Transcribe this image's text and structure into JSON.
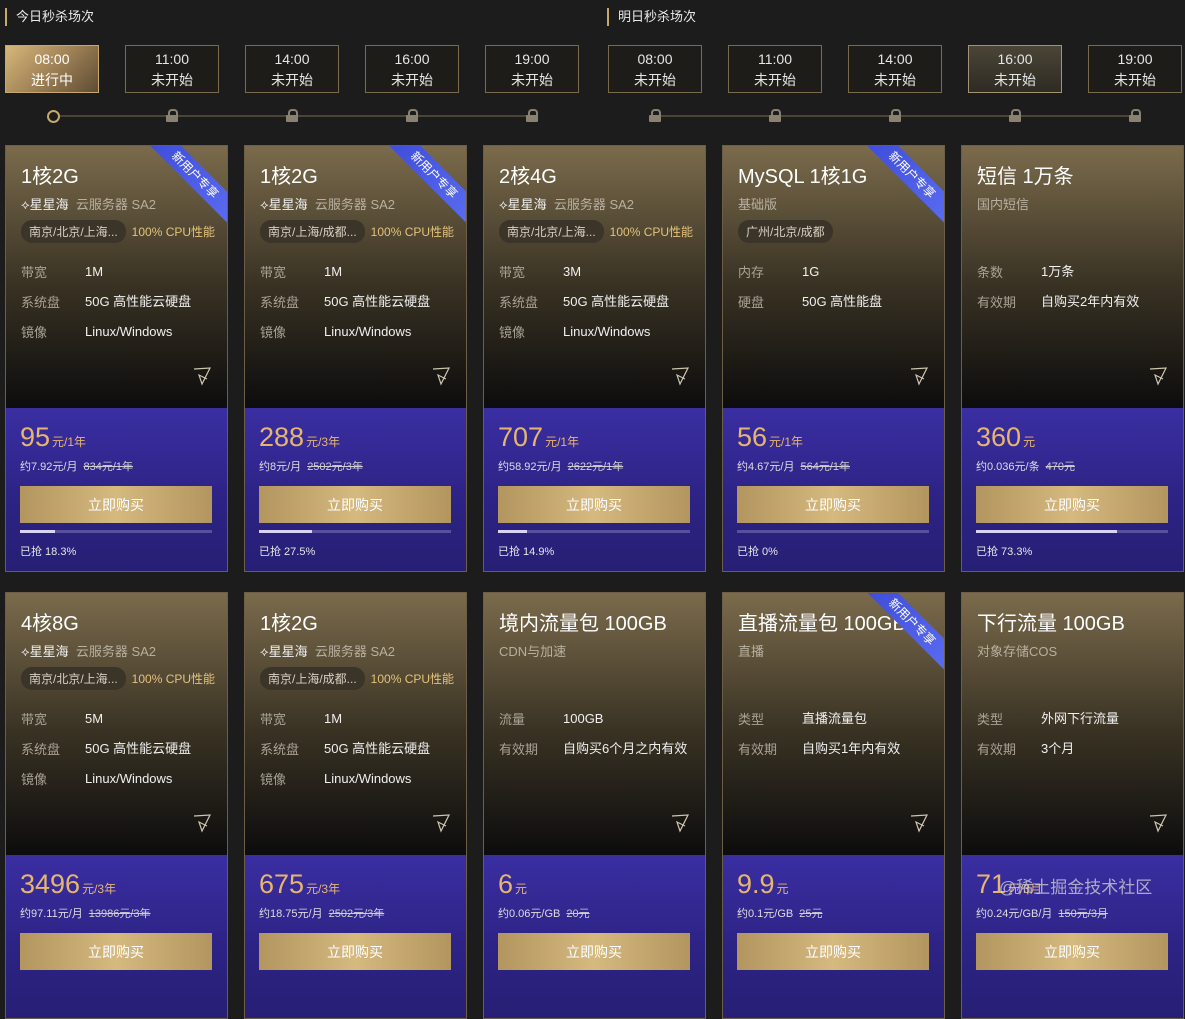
{
  "sections": {
    "today": "今日秒杀场次",
    "tomorrow": "明日秒杀场次"
  },
  "today_slots": [
    {
      "time": "08:00",
      "status": "进行中"
    },
    {
      "time": "11:00",
      "status": "未开始"
    },
    {
      "time": "14:00",
      "status": "未开始"
    },
    {
      "time": "16:00",
      "status": "未开始"
    },
    {
      "time": "19:00",
      "status": "未开始"
    }
  ],
  "tomorrow_slots": [
    {
      "time": "08:00",
      "status": "未开始"
    },
    {
      "time": "11:00",
      "status": "未开始"
    },
    {
      "time": "14:00",
      "status": "未开始"
    },
    {
      "time": "16:00",
      "status": "未开始"
    },
    {
      "time": "19:00",
      "status": "未开始"
    }
  ],
  "badge_text": "新用户专享",
  "buy_label": "立即购买",
  "cards": [
    {
      "title": "1核2G",
      "logo": "星星海",
      "product": "云服务器 SA2",
      "badge": true,
      "loc": "南京/北京/上海...",
      "cpu": "100% CPU性能",
      "specs": [
        {
          "k": "带宽",
          "v": "1M"
        },
        {
          "k": "系统盘",
          "v": "50G 高性能云硬盘"
        },
        {
          "k": "镜像",
          "v": "Linux/Windows"
        }
      ],
      "price": "95",
      "price_unit": "元/1年",
      "per": "约7.92元/月",
      "orig": "834元/1年",
      "sold": "已抢 18.3%",
      "sold_fraction": 0.183
    },
    {
      "title": "1核2G",
      "logo": "星星海",
      "product": "云服务器 SA2",
      "badge": true,
      "loc": "南京/上海/成都...",
      "cpu": "100% CPU性能",
      "specs": [
        {
          "k": "带宽",
          "v": "1M"
        },
        {
          "k": "系统盘",
          "v": "50G 高性能云硬盘"
        },
        {
          "k": "镜像",
          "v": "Linux/Windows"
        }
      ],
      "price": "288",
      "price_unit": "元/3年",
      "per": "约8元/月",
      "orig": "2502元/3年",
      "sold": "已抢 27.5%",
      "sold_fraction": 0.275
    },
    {
      "title": "2核4G",
      "logo": "星星海",
      "product": "云服务器 SA2",
      "badge": false,
      "loc": "南京/北京/上海...",
      "cpu": "100% CPU性能",
      "specs": [
        {
          "k": "带宽",
          "v": "3M"
        },
        {
          "k": "系统盘",
          "v": "50G 高性能云硬盘"
        },
        {
          "k": "镜像",
          "v": "Linux/Windows"
        }
      ],
      "price": "707",
      "price_unit": "元/1年",
      "per": "约58.92元/月",
      "orig": "2622元/1年",
      "sold": "已抢 14.9%",
      "sold_fraction": 0.149
    },
    {
      "title": "MySQL 1核1G",
      "logo": "",
      "product": "基础版",
      "badge": true,
      "loc": "广州/北京/成都",
      "cpu": "",
      "specs": [
        {
          "k": "内存",
          "v": "1G"
        },
        {
          "k": "硬盘",
          "v": "50G 高性能盘"
        }
      ],
      "price": "56",
      "price_unit": "元/1年",
      "per": "约4.67元/月",
      "orig": "564元/1年",
      "sold": "已抢 0%",
      "sold_fraction": 0
    },
    {
      "title": "短信 1万条",
      "logo": "",
      "product": "国内短信",
      "badge": false,
      "loc": "",
      "cpu": "",
      "specs": [
        {
          "k": "条数",
          "v": "1万条"
        },
        {
          "k": "有效期",
          "v": "自购买2年内有效"
        }
      ],
      "price": "360",
      "price_unit": "元",
      "per": "约0.036元/条",
      "orig": "470元",
      "sold": "已抢 73.3%",
      "sold_fraction": 0.733
    },
    {
      "title": "4核8G",
      "logo": "星星海",
      "product": "云服务器 SA2",
      "badge": false,
      "loc": "南京/北京/上海...",
      "cpu": "100% CPU性能",
      "specs": [
        {
          "k": "带宽",
          "v": "5M"
        },
        {
          "k": "系统盘",
          "v": "50G 高性能云硬盘"
        },
        {
          "k": "镜像",
          "v": "Linux/Windows"
        }
      ],
      "price": "3496",
      "price_unit": "元/3年",
      "per": "约97.11元/月",
      "orig": "13986元/3年",
      "sold": "",
      "sold_fraction": null
    },
    {
      "title": "1核2G",
      "logo": "星星海",
      "product": "云服务器 SA2",
      "badge": false,
      "loc": "南京/上海/成都...",
      "cpu": "100% CPU性能",
      "specs": [
        {
          "k": "带宽",
          "v": "1M"
        },
        {
          "k": "系统盘",
          "v": "50G 高性能云硬盘"
        },
        {
          "k": "镜像",
          "v": "Linux/Windows"
        }
      ],
      "price": "675",
      "price_unit": "元/3年",
      "per": "约18.75元/月",
      "orig": "2502元/3年",
      "sold": "",
      "sold_fraction": null
    },
    {
      "title": "境内流量包 100GB",
      "logo": "",
      "product": "CDN与加速",
      "badge": false,
      "loc": "",
      "cpu": "",
      "specs": [
        {
          "k": "流量",
          "v": "100GB"
        },
        {
          "k": "有效期",
          "v": "自购买6个月之内有效"
        }
      ],
      "price": "6",
      "price_unit": "元",
      "per": "约0.06元/GB",
      "orig": "20元",
      "sold": "",
      "sold_fraction": null
    },
    {
      "title": "直播流量包 100GB",
      "logo": "",
      "product": "直播",
      "badge": true,
      "loc": "",
      "cpu": "",
      "specs": [
        {
          "k": "类型",
          "v": "直播流量包"
        },
        {
          "k": "有效期",
          "v": "自购买1年内有效"
        }
      ],
      "price": "9.9",
      "price_unit": "元",
      "per": "约0.1元/GB",
      "orig": "25元",
      "sold": "",
      "sold_fraction": null
    },
    {
      "title": "下行流量 100GB",
      "logo": "",
      "product": "对象存储COS",
      "badge": false,
      "loc": "",
      "cpu": "",
      "specs": [
        {
          "k": "类型",
          "v": "外网下行流量"
        },
        {
          "k": "有效期",
          "v": "3个月"
        }
      ],
      "price": "71",
      "price_unit": "元/3月",
      "per": "约0.24元/GB/月",
      "orig": "150元/3月",
      "sold": "",
      "sold_fraction": null
    }
  ],
  "watermark": "@稀土掘金技术社区",
  "colors": {
    "gold": "#c8a868",
    "price": "#e7b66e",
    "purple": "#2d2385",
    "badge": "#4a5ae6"
  }
}
